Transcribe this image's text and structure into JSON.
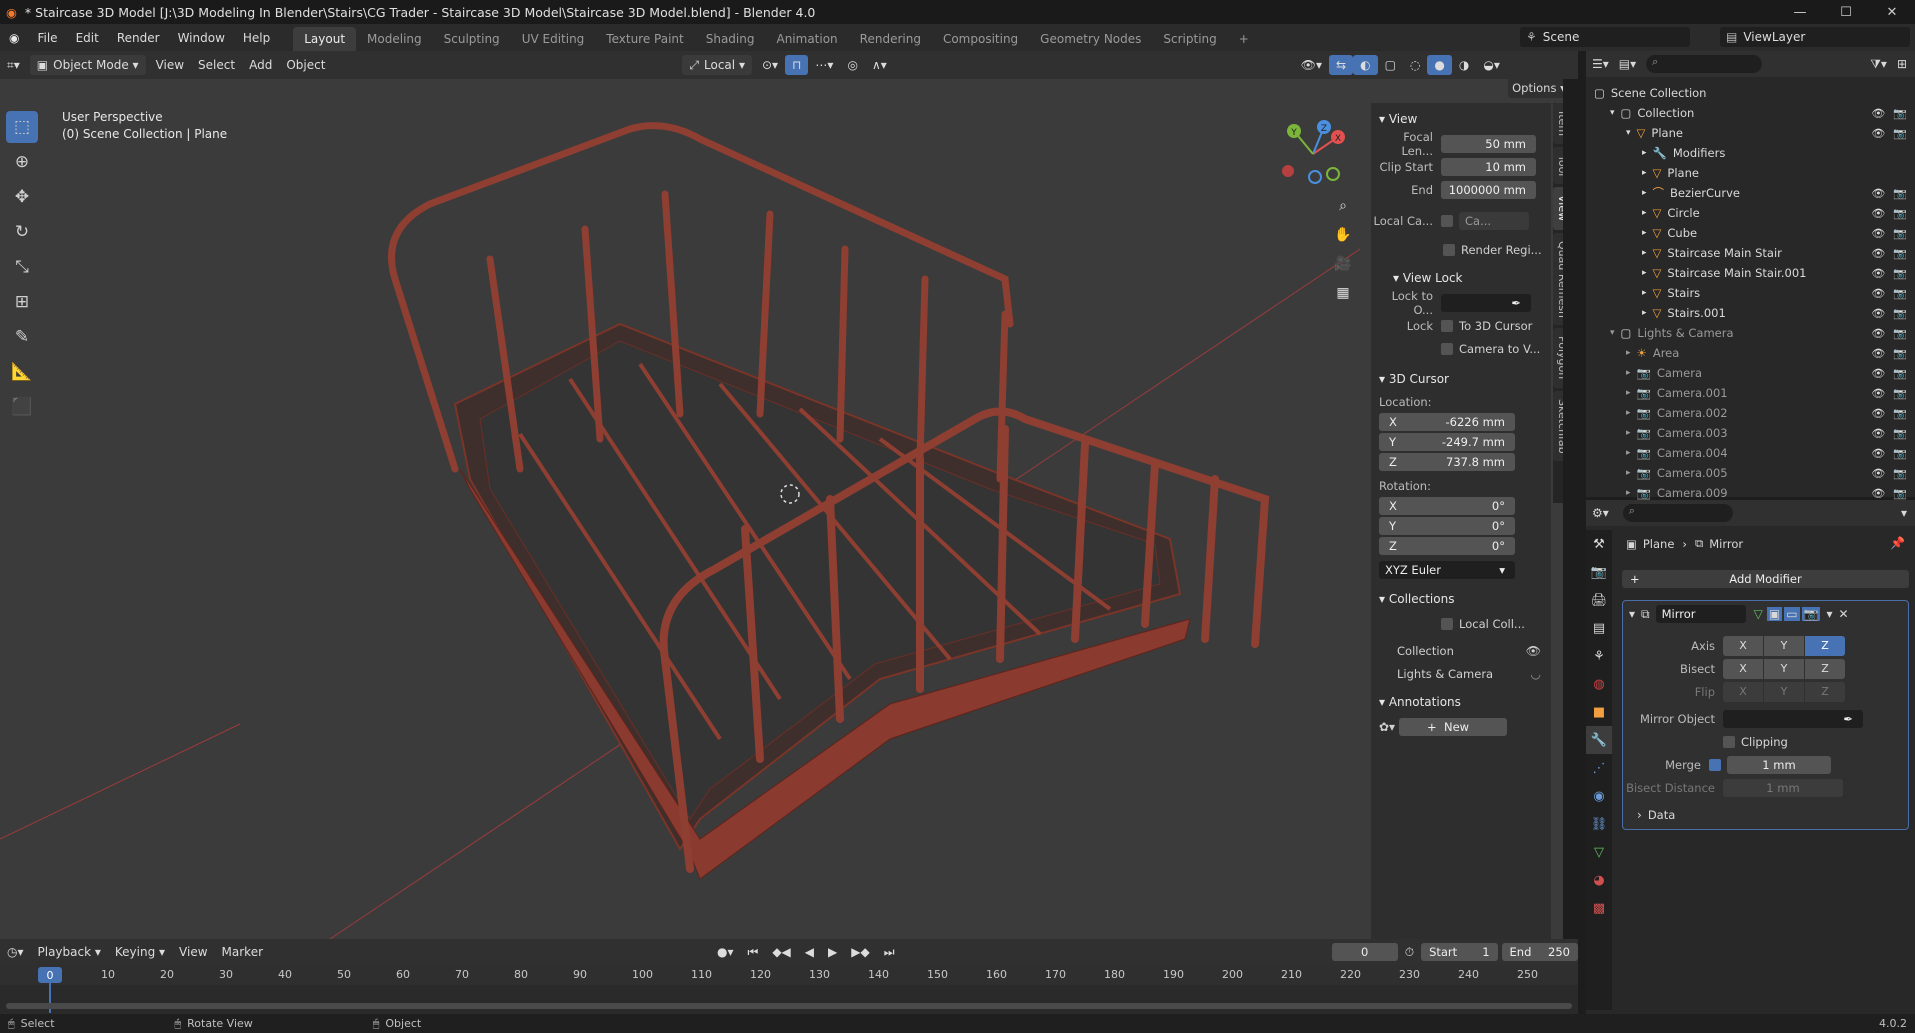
{
  "window": {
    "title": "* Staircase 3D Model [J:\\3D Modeling In Blender\\Stairs\\CG Trader - Staircase 3D Model\\Staircase 3D Model.blend] - Blender 4.0"
  },
  "menu": [
    "File",
    "Edit",
    "Render",
    "Window",
    "Help"
  ],
  "workspaces": [
    "Layout",
    "Modeling",
    "Sculpting",
    "UV Editing",
    "Texture Paint",
    "Shading",
    "Animation",
    "Rendering",
    "Compositing",
    "Geometry Nodes",
    "Scripting"
  ],
  "scene": {
    "label": "Scene",
    "view_layer": "ViewLayer"
  },
  "viewport_header": {
    "mode": "Object Mode",
    "menus": [
      "View",
      "Select",
      "Add",
      "Object"
    ],
    "transform_orientation": "Local",
    "options": "Options"
  },
  "viewport": {
    "perspective": "User Perspective",
    "collection_info": "(0) Scene Collection | Plane",
    "gizmo_axes": [
      "X",
      "Y",
      "Z"
    ]
  },
  "npanel": {
    "tabs": [
      "Item",
      "Tool",
      "View",
      "Quad Remesh",
      "Polygon",
      "Sketchfab"
    ],
    "view_section": "View",
    "focal_label": "Focal Len...",
    "focal_value": "50 mm",
    "clip_start_label": "Clip Start",
    "clip_start_value": "10 mm",
    "clip_end_label": "End",
    "clip_end_value": "1000000 mm",
    "local_camera_label": "Local Ca...",
    "local_camera_value": "Ca...",
    "render_region": "Render Regi...",
    "view_lock_section": "View Lock",
    "lock_to_label": "Lock to O...",
    "lock_label": "Lock",
    "lock_to_cursor": "To 3D Cursor",
    "camera_to_view": "Camera to V...",
    "cursor_section": "3D Cursor",
    "location_label": "Location:",
    "loc": [
      {
        "axis": "X",
        "value": "-6226 mm"
      },
      {
        "axis": "Y",
        "value": "-249.7 mm"
      },
      {
        "axis": "Z",
        "value": "737.8 mm"
      }
    ],
    "rotation_label": "Rotation:",
    "rot": [
      {
        "axis": "X",
        "value": "0°"
      },
      {
        "axis": "Y",
        "value": "0°"
      },
      {
        "axis": "Z",
        "value": "0°"
      }
    ],
    "rotation_mode": "XYZ Euler",
    "collections_section": "Collections",
    "local_collections": "Local Coll...",
    "collection_items": [
      "Collection",
      "Lights & Camera"
    ],
    "annotations_section": "Annotations",
    "new_label": "New"
  },
  "outliner": {
    "root": "Scene Collection",
    "rows": [
      {
        "name": "Collection",
        "indent": 1
      },
      {
        "name": "Plane",
        "indent": 2
      },
      {
        "name": "Modifiers",
        "indent": 3
      },
      {
        "name": "Plane",
        "indent": 3
      },
      {
        "name": "BezierCurve",
        "indent": 3
      },
      {
        "name": "Circle",
        "indent": 3
      },
      {
        "name": "Cube",
        "indent": 3
      },
      {
        "name": "Staircase Main Stair",
        "indent": 3
      },
      {
        "name": "Staircase Main Stair.001",
        "indent": 3
      },
      {
        "name": "Stairs",
        "indent": 3
      },
      {
        "name": "Stairs.001",
        "indent": 3
      },
      {
        "name": "Lights & Camera",
        "indent": 1
      },
      {
        "name": "Area",
        "indent": 2
      },
      {
        "name": "Camera",
        "indent": 2
      },
      {
        "name": "Camera.001",
        "indent": 2
      },
      {
        "name": "Camera.002",
        "indent": 2
      },
      {
        "name": "Camera.003",
        "indent": 2
      },
      {
        "name": "Camera.004",
        "indent": 2
      },
      {
        "name": "Camera.005",
        "indent": 2
      },
      {
        "name": "Camera.009",
        "indent": 2
      }
    ]
  },
  "properties": {
    "breadcrumb_object": "Plane",
    "breadcrumb_modifier": "Mirror",
    "add_modifier": "Add Modifier",
    "modifier_name": "Mirror",
    "axis_label": "Axis",
    "bisect_label": "Bisect",
    "flip_label": "Flip",
    "axes": [
      "X",
      "Y",
      "Z"
    ],
    "mirror_object_label": "Mirror Object",
    "clipping_label": "Clipping",
    "merge_label": "Merge",
    "merge_value": "1 mm",
    "bisect_distance_label": "Bisect Distance",
    "bisect_distance_value": "1 mm",
    "data_label": "Data"
  },
  "timeline": {
    "menus": [
      "Playback",
      "Keying",
      "View",
      "Marker"
    ],
    "current_frame": "0",
    "start_label": "Start",
    "start_value": "1",
    "end_label": "End",
    "end_value": "250",
    "ticks": [
      "0",
      "10",
      "20",
      "30",
      "40",
      "50",
      "60",
      "70",
      "80",
      "90",
      "100",
      "110",
      "120",
      "130",
      "140",
      "150",
      "160",
      "170",
      "180",
      "190",
      "200",
      "210",
      "220",
      "230",
      "240",
      "250"
    ]
  },
  "statusbar": {
    "select": "Select",
    "rotate": "Rotate View",
    "object": "Object",
    "version": "4.0.2"
  },
  "colors": {
    "accent": "#4772b3",
    "rail": "#8f3e32",
    "viewport_bg": "#3b3b3b"
  }
}
